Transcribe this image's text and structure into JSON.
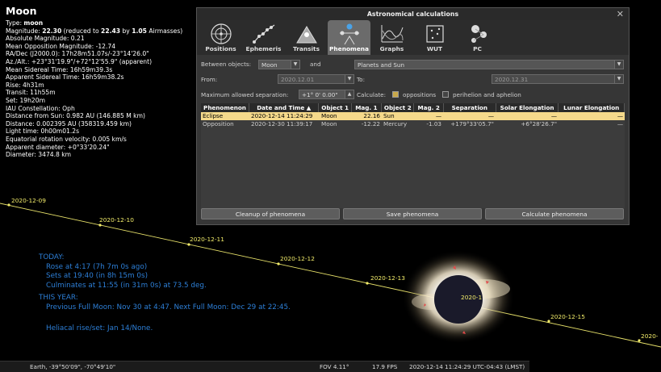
{
  "object_info": {
    "name": "Moon",
    "type_label": "Type:",
    "type_value": "moon",
    "magnitude_label": "Magnitude:",
    "magnitude_value": "22.30",
    "magnitude_reduced_text": "(reduced to",
    "magnitude_reduced_value": "22.43",
    "magnitude_by_text": "by",
    "airmasses_value": "1.05",
    "airmasses_text": "Airmasses)",
    "lines": [
      "Absolute Magnitude: 0.21",
      "Mean Opposition Magnitude: -12.74",
      "RA/Dec (J2000.0): 17h28m51.07s/-23°14'26.0\"",
      "Az./Alt.: +23°31'19.9\"/+72°12'55.9\" (apparent)",
      "Mean Sidereal Time: 16h59m39.3s",
      "Apparent Sidereal Time: 16h59m38.2s",
      "Rise: 4h31m",
      "Transit: 11h55m",
      "Set: 19h20m",
      "IAU Constellation: Oph",
      "Distance from Sun: 0.982 AU (146.885 M km)",
      "Distance: 0.002395 AU (358319.459 km)",
      "Light time: 0h00m01.2s",
      "Equatorial rotation velocity: 0.005 km/s",
      "Apparent diameter: +0°33'20.24\"",
      "Diameter: 3474.8 km"
    ]
  },
  "today": {
    "heading": "TODAY:",
    "rose": "Rose at 4:17 (7h 7m 0s ago)",
    "sets": "Sets at 19:40 (in 8h 15m 0s)",
    "culminates": "Culminates at 11:55 (in 31m 0s) at 73.5 deg.",
    "year_heading": "THIS YEAR:",
    "moons": "Previous Full Moon: Nov 30 at 4:47. Next Full Moon: Dec 29 at 22:45.",
    "heliacal": "Heliacal rise/set: Jan 14/None."
  },
  "ecliptic_dates": [
    "2020-12-09",
    "2020-12-10",
    "2020-12-11",
    "2020-12-12",
    "2020-12-13",
    "2020-1",
    "2020-12-15",
    "2020-"
  ],
  "dialog": {
    "title": "Astronomical calculations",
    "close": "✕",
    "tabs": [
      {
        "label": "Positions",
        "icon": "positions-icon"
      },
      {
        "label": "Ephemeris",
        "icon": "ephemeris-icon"
      },
      {
        "label": "Transits",
        "icon": "transits-icon"
      },
      {
        "label": "Phenomena",
        "icon": "phenomena-icon",
        "active": true
      },
      {
        "label": "Graphs",
        "icon": "graphs-icon"
      },
      {
        "label": "WUT",
        "icon": "wut-icon"
      },
      {
        "label": "PC",
        "icon": "pc-icon"
      }
    ],
    "between_label": "Between objects:",
    "object1": "Moon",
    "and_label": "and",
    "object2": "Planets and Sun",
    "from_label": "From:",
    "from_value": "2020.12.01",
    "to_label": "To:",
    "to_value": "2020.12.31",
    "max_sep_label": "Maximum allowed separation:",
    "max_sep_value": "+1° 0' 0.00\"",
    "calculate_label": "Calculate:",
    "oppositions_label": "oppositions",
    "oppositions_checked": true,
    "perihelion_label": "perihelion and aphelion",
    "perihelion_checked": false,
    "columns": [
      "Phenomenon",
      "Date and Time ▲",
      "Object 1",
      "Mag. 1",
      "Object 2",
      "Mag. 2",
      "Separation",
      "Solar Elongation",
      "Lunar Elongation"
    ],
    "rows": [
      [
        "Eclipse",
        "2020-12-14 11:24:29",
        "Moon",
        "22.16",
        "Sun",
        "—",
        "—",
        "—",
        "—"
      ],
      [
        "Opposition",
        "2020-12-30 11:39:17",
        "Moon",
        "-12.22",
        "Mercury",
        "-1.03",
        "+179°33'05.7\"",
        "+6°28'26.7\"",
        "—"
      ]
    ],
    "btn_cleanup": "Cleanup of phenomena",
    "btn_save": "Save phenomena",
    "btn_calculate": "Calculate phenomena"
  },
  "bottom_bar": {
    "location": "Earth, -39°50'09\", -70°49'10\"",
    "fov": "FOV 4.11°",
    "fps": "17.9 FPS",
    "datetime": "2020-12-14 11:24:29 UTC-04:43 (LMST)"
  },
  "colors": {
    "ecliptic": "#f2ec6a",
    "today_text": "#2d7fd7",
    "selected_row": "#f5d98b"
  }
}
